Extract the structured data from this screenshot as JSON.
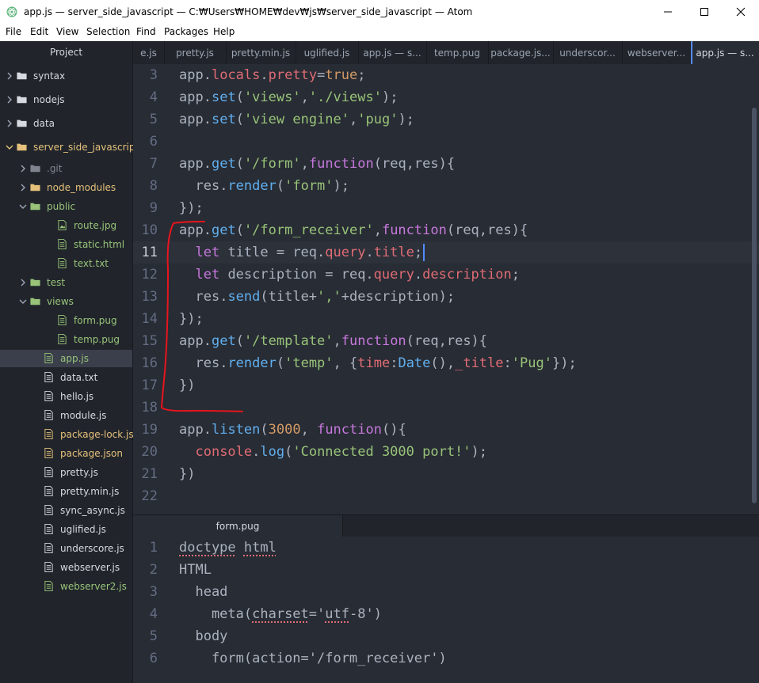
{
  "window": {
    "title": "app.js — server_side_javascript — C:₩Users₩HOME₩dev₩js₩server_side_javascript — Atom",
    "icon": "atom-icon",
    "controls": [
      "minimize-icon",
      "maximize-icon",
      "close-icon"
    ]
  },
  "menu": [
    "File",
    "Edit",
    "View",
    "Selection",
    "Find",
    "Packages",
    "Help"
  ],
  "sidebar": {
    "header": "Project",
    "tree": [
      {
        "label": "syntax",
        "type": "folder",
        "expanded": false,
        "color": "#d7dae0"
      },
      {
        "label": "nodejs",
        "type": "folder",
        "expanded": false,
        "color": "#d7dae0"
      },
      {
        "label": "data",
        "type": "folder",
        "expanded": false,
        "color": "#d7dae0"
      },
      {
        "label": "server_side_javascript",
        "type": "folder",
        "expanded": true,
        "color": "#e5c07b"
      },
      {
        "label": ".git",
        "type": "folder",
        "expanded": false,
        "color": "#7f848e"
      },
      {
        "label": "node_modules",
        "type": "folder",
        "expanded": false,
        "color": "#e5c07b"
      },
      {
        "label": "public",
        "type": "folder",
        "expanded": true,
        "color": "#98c379"
      },
      {
        "label": "route.jpg",
        "type": "image",
        "color": "#98c379"
      },
      {
        "label": "static.html",
        "type": "file",
        "color": "#98c379"
      },
      {
        "label": "text.txt",
        "type": "file",
        "color": "#98c379"
      },
      {
        "label": "test",
        "type": "folder",
        "expanded": false,
        "color": "#98c379"
      },
      {
        "label": "views",
        "type": "folder",
        "expanded": true,
        "color": "#98c379"
      },
      {
        "label": "form.pug",
        "type": "file",
        "color": "#98c379"
      },
      {
        "label": "temp.pug",
        "type": "file",
        "color": "#98c379"
      },
      {
        "label": "app.js",
        "type": "file",
        "color": "#98c379",
        "selected": true
      },
      {
        "label": "data.txt",
        "type": "file",
        "color": "#d7dae0"
      },
      {
        "label": "hello.js",
        "type": "file",
        "color": "#d7dae0"
      },
      {
        "label": "module.js",
        "type": "file",
        "color": "#d7dae0"
      },
      {
        "label": "package-lock.json",
        "type": "file",
        "color": "#e5c07b"
      },
      {
        "label": "package.json",
        "type": "file",
        "color": "#e5c07b"
      },
      {
        "label": "pretty.js",
        "type": "file",
        "color": "#d7dae0"
      },
      {
        "label": "pretty.min.js",
        "type": "file",
        "color": "#d7dae0"
      },
      {
        "label": "sync_async.js",
        "type": "file",
        "color": "#d7dae0"
      },
      {
        "label": "uglified.js",
        "type": "file",
        "color": "#d7dae0"
      },
      {
        "label": "underscore.js",
        "type": "file",
        "color": "#d7dae0"
      },
      {
        "label": "webserver.js",
        "type": "file",
        "color": "#d7dae0"
      },
      {
        "label": "webserver2.js",
        "type": "file",
        "color": "#98c379"
      }
    ]
  },
  "tabs": [
    "e.js",
    "pretty.js",
    "pretty.min.js",
    "uglified.js",
    "app.js — s...",
    "temp.pug",
    "package.js...",
    "underscor...",
    "webserver...",
    "app.js — s..."
  ],
  "active_tab_index": 9,
  "editor": {
    "cursor_line": 11,
    "lines": [
      {
        "num": "3",
        "tokens": [
          [
            "app",
            "t"
          ],
          [
            ".",
            "t"
          ],
          [
            "locals",
            "p"
          ],
          [
            ".",
            "t"
          ],
          [
            "pretty",
            "p"
          ],
          [
            "=",
            "t"
          ],
          [
            "true",
            "n"
          ],
          [
            ";",
            "t"
          ]
        ]
      },
      {
        "num": "4",
        "tokens": [
          [
            "app",
            "t"
          ],
          [
            ".",
            "t"
          ],
          [
            "set",
            "f"
          ],
          [
            "(",
            "t"
          ],
          [
            "'views'",
            "s"
          ],
          [
            ",",
            "t"
          ],
          [
            "'./views'",
            "s"
          ],
          [
            ");",
            "t"
          ]
        ]
      },
      {
        "num": "5",
        "tokens": [
          [
            "app",
            "t"
          ],
          [
            ".",
            "t"
          ],
          [
            "set",
            "f"
          ],
          [
            "(",
            "t"
          ],
          [
            "'view engine'",
            "s"
          ],
          [
            ",",
            "t"
          ],
          [
            "'pug'",
            "s"
          ],
          [
            ");",
            "t"
          ]
        ]
      },
      {
        "num": "6",
        "tokens": []
      },
      {
        "num": "7",
        "tokens": [
          [
            "app",
            "t"
          ],
          [
            ".",
            "t"
          ],
          [
            "get",
            "f"
          ],
          [
            "(",
            "t"
          ],
          [
            "'/form'",
            "s"
          ],
          [
            ",",
            "t"
          ],
          [
            "function",
            "k"
          ],
          [
            "(req,res){",
            "t"
          ]
        ]
      },
      {
        "num": "8",
        "tokens": [
          [
            "  res",
            "t"
          ],
          [
            ".",
            "t"
          ],
          [
            "render",
            "f"
          ],
          [
            "(",
            "t"
          ],
          [
            "'form'",
            "s"
          ],
          [
            ");",
            "t"
          ]
        ]
      },
      {
        "num": "9",
        "tokens": [
          [
            "});",
            "t"
          ]
        ]
      },
      {
        "num": "10",
        "tokens": [
          [
            "app",
            "t"
          ],
          [
            ".",
            "t"
          ],
          [
            "get",
            "f"
          ],
          [
            "(",
            "t"
          ],
          [
            "'/form_receiver'",
            "s"
          ],
          [
            ",",
            "t"
          ],
          [
            "function",
            "k"
          ],
          [
            "(req,res){",
            "t"
          ]
        ]
      },
      {
        "num": "11",
        "tokens": [
          [
            "  ",
            "t"
          ],
          [
            "let",
            "k"
          ],
          [
            " title = req.",
            "t"
          ],
          [
            "query",
            "p"
          ],
          [
            ".",
            "t"
          ],
          [
            "title",
            "p"
          ],
          [
            ";",
            "t"
          ]
        ]
      },
      {
        "num": "12",
        "tokens": [
          [
            "  ",
            "t"
          ],
          [
            "let",
            "k"
          ],
          [
            " description = req.",
            "t"
          ],
          [
            "query",
            "p"
          ],
          [
            ".",
            "t"
          ],
          [
            "description",
            "p"
          ],
          [
            ";",
            "t"
          ]
        ]
      },
      {
        "num": "13",
        "tokens": [
          [
            "  res",
            "t"
          ],
          [
            ".",
            "t"
          ],
          [
            "send",
            "f"
          ],
          [
            "(title+",
            "t"
          ],
          [
            "','",
            "s"
          ],
          [
            "+description);",
            "t"
          ]
        ]
      },
      {
        "num": "14",
        "tokens": [
          [
            "});",
            "t"
          ]
        ]
      },
      {
        "num": "15",
        "tokens": [
          [
            "app",
            "t"
          ],
          [
            ".",
            "t"
          ],
          [
            "get",
            "f"
          ],
          [
            "(",
            "t"
          ],
          [
            "'/template'",
            "s"
          ],
          [
            ",",
            "t"
          ],
          [
            "function",
            "k"
          ],
          [
            "(req,res){",
            "t"
          ]
        ]
      },
      {
        "num": "16",
        "tokens": [
          [
            "  res",
            "t"
          ],
          [
            ".",
            "t"
          ],
          [
            "render",
            "f"
          ],
          [
            "(",
            "t"
          ],
          [
            "'temp'",
            "s"
          ],
          [
            ", {",
            "t"
          ],
          [
            "time",
            "p"
          ],
          [
            ":",
            "t"
          ],
          [
            "Date",
            "f"
          ],
          [
            "(),",
            "t"
          ],
          [
            "_title",
            "p"
          ],
          [
            ":",
            "t"
          ],
          [
            "'Pug'",
            "s"
          ],
          [
            "});",
            "t"
          ]
        ]
      },
      {
        "num": "17",
        "tokens": [
          [
            "})",
            "t"
          ]
        ]
      },
      {
        "num": "18",
        "tokens": []
      },
      {
        "num": "19",
        "tokens": [
          [
            "app",
            "t"
          ],
          [
            ".",
            "t"
          ],
          [
            "listen",
            "f"
          ],
          [
            "(",
            "t"
          ],
          [
            "3000",
            "n"
          ],
          [
            ", ",
            "t"
          ],
          [
            "function",
            "k"
          ],
          [
            "(){",
            "t"
          ]
        ]
      },
      {
        "num": "20",
        "tokens": [
          [
            "  ",
            "t"
          ],
          [
            "console",
            "p"
          ],
          [
            ".",
            "t"
          ],
          [
            "log",
            "f"
          ],
          [
            "(",
            "t"
          ],
          [
            "'Connected 3000 port!'",
            "s"
          ],
          [
            ");",
            "t"
          ]
        ]
      },
      {
        "num": "21",
        "tokens": [
          [
            "})",
            "t"
          ]
        ]
      },
      {
        "num": "22",
        "tokens": []
      }
    ]
  },
  "pane2": {
    "tab": "form.pug",
    "lines": [
      {
        "num": "1",
        "tokens": [
          [
            "doctype",
            "e"
          ],
          [
            " ",
            "t"
          ],
          [
            "html",
            "e"
          ]
        ]
      },
      {
        "num": "2",
        "tokens": [
          [
            "HTML",
            "t"
          ]
        ]
      },
      {
        "num": "3",
        "tokens": [
          [
            "  head",
            "t"
          ]
        ]
      },
      {
        "num": "4",
        "tokens": [
          [
            "    meta(",
            "t"
          ],
          [
            "charset",
            "e"
          ],
          [
            "='",
            "t"
          ],
          [
            "utf",
            "e"
          ],
          [
            "-8')",
            "t"
          ]
        ]
      },
      {
        "num": "5",
        "tokens": [
          [
            "  body",
            "t"
          ]
        ]
      },
      {
        "num": "6",
        "tokens": [
          [
            "    form(action='/form_receiver')",
            "t"
          ]
        ]
      }
    ]
  },
  "colors": {
    "accent": "#568af2",
    "annotation": "#e8141e",
    "background": "#282c34",
    "panel": "#21252b"
  }
}
